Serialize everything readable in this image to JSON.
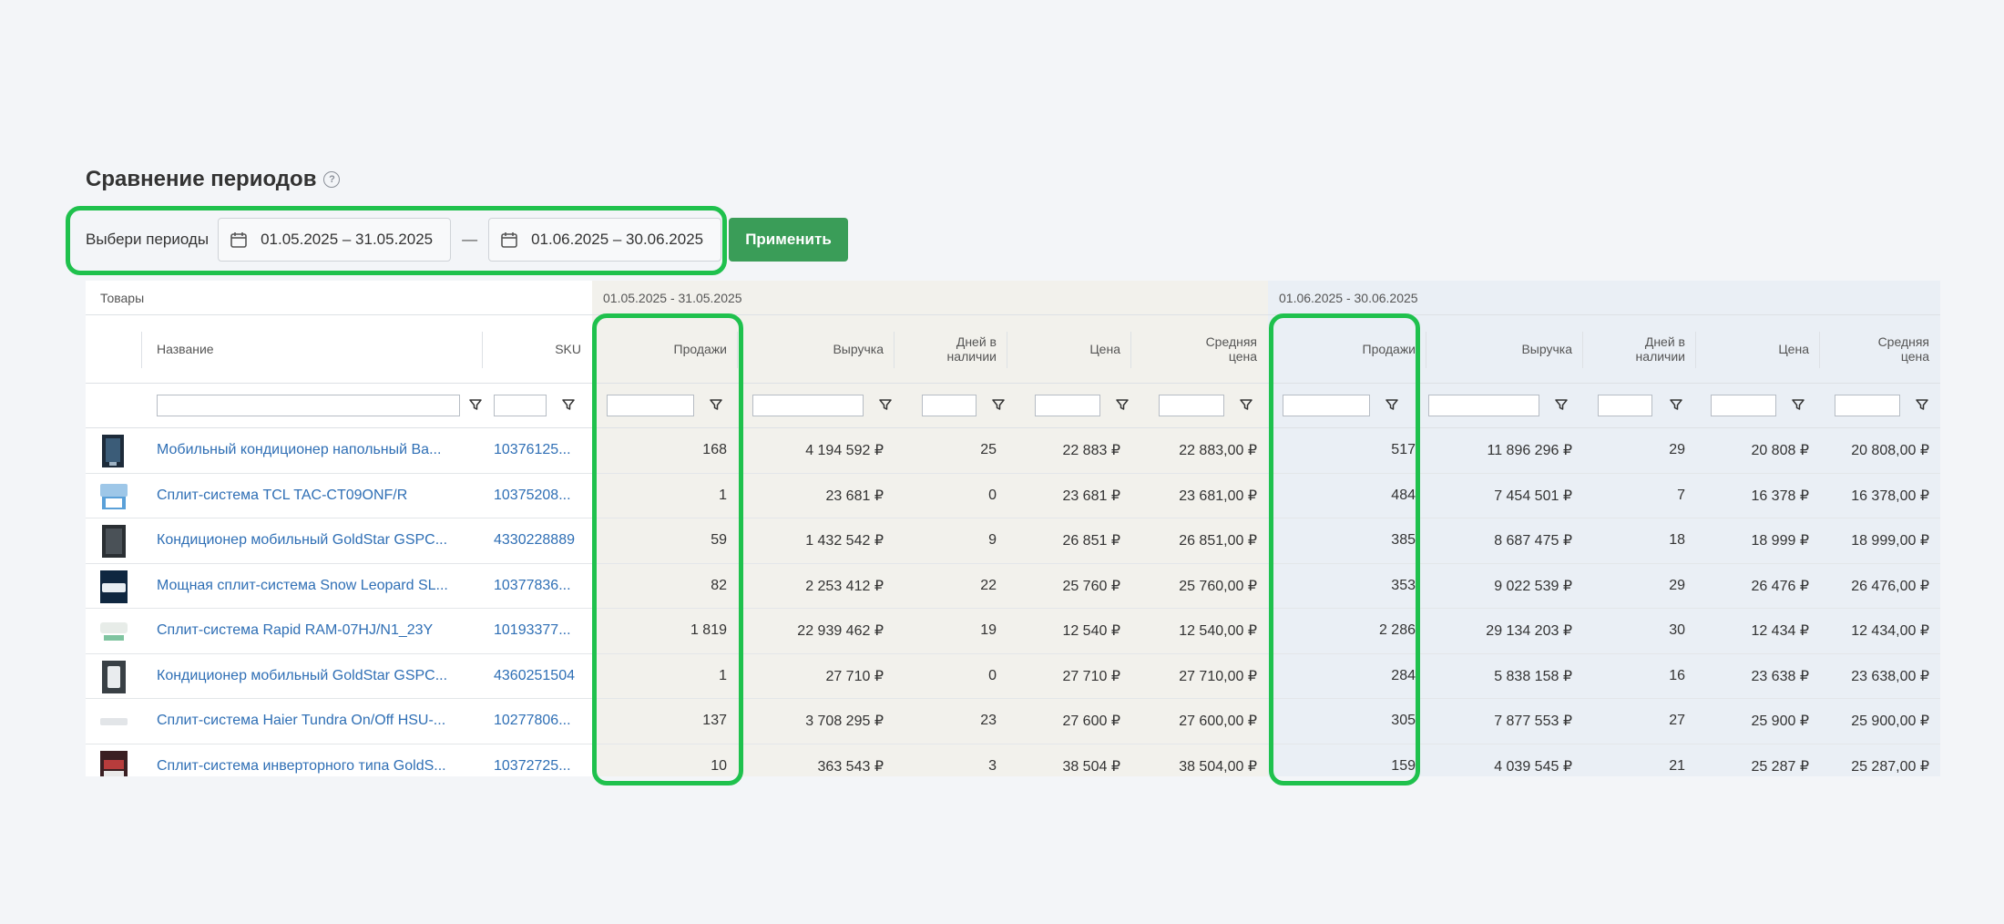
{
  "page": {
    "title": "Сравнение периодов",
    "help_icon": "?",
    "period_label": "Выбери периоды",
    "period1": "01.05.2025 – 31.05.2025",
    "period_sep": "—",
    "period2": "01.06.2025 – 30.06.2025",
    "apply_label": "Применить"
  },
  "table": {
    "group_products": "Товары",
    "group_period1": "01.05.2025 - 31.05.2025",
    "group_period2": "01.06.2025 - 30.06.2025",
    "col_name": "Название",
    "col_sku": "SKU",
    "col_sales": "Продажи",
    "col_revenue": "Выручка",
    "col_days": "Дней в наличии",
    "col_price": "Цена",
    "col_avg_price": "Средняя цена",
    "rows": [
      {
        "name": "Мобильный кондиционер напольный Ва...",
        "sku": "10376125...",
        "p1": {
          "sales": "168",
          "rev": "4 194 592 ₽",
          "days": "25",
          "price": "22 883 ₽",
          "avg": "22 883,00 ₽"
        },
        "p2": {
          "sales": "517",
          "rev": "11 896 296 ₽",
          "days": "29",
          "price": "20 808 ₽",
          "avg": "20 808,00 ₽"
        }
      },
      {
        "name": "Сплит-система TCL TAC-CT09ONF/R",
        "sku": "10375208...",
        "p1": {
          "sales": "1",
          "rev": "23 681 ₽",
          "days": "0",
          "price": "23 681 ₽",
          "avg": "23 681,00 ₽"
        },
        "p2": {
          "sales": "484",
          "rev": "7 454 501 ₽",
          "days": "7",
          "price": "16 378 ₽",
          "avg": "16 378,00 ₽"
        }
      },
      {
        "name": "Кондиционер мобильный GoldStar GSPC...",
        "sku": "4330228889",
        "p1": {
          "sales": "59",
          "rev": "1 432 542 ₽",
          "days": "9",
          "price": "26 851 ₽",
          "avg": "26 851,00 ₽"
        },
        "p2": {
          "sales": "385",
          "rev": "8 687 475 ₽",
          "days": "18",
          "price": "18 999 ₽",
          "avg": "18 999,00 ₽"
        }
      },
      {
        "name": "Мощная сплит-система Snow Leopard SL...",
        "sku": "10377836...",
        "p1": {
          "sales": "82",
          "rev": "2 253 412 ₽",
          "days": "22",
          "price": "25 760 ₽",
          "avg": "25 760,00 ₽"
        },
        "p2": {
          "sales": "353",
          "rev": "9 022 539 ₽",
          "days": "29",
          "price": "26 476 ₽",
          "avg": "26 476,00 ₽"
        }
      },
      {
        "name": "Сплит-система Rapid RAM-07HJ/N1_23Y",
        "sku": "10193377...",
        "p1": {
          "sales": "1 819",
          "rev": "22 939 462 ₽",
          "days": "19",
          "price": "12 540 ₽",
          "avg": "12 540,00 ₽"
        },
        "p2": {
          "sales": "2 286",
          "rev": "29 134 203 ₽",
          "days": "30",
          "price": "12 434 ₽",
          "avg": "12 434,00 ₽"
        }
      },
      {
        "name": "Кондиционер мобильный GoldStar GSPC...",
        "sku": "4360251504",
        "p1": {
          "sales": "1",
          "rev": "27 710 ₽",
          "days": "0",
          "price": "27 710 ₽",
          "avg": "27 710,00 ₽"
        },
        "p2": {
          "sales": "284",
          "rev": "5 838 158 ₽",
          "days": "16",
          "price": "23 638 ₽",
          "avg": "23 638,00 ₽"
        }
      },
      {
        "name": "Сплит-система Haier Tundra On/Off HSU-...",
        "sku": "10277806...",
        "p1": {
          "sales": "137",
          "rev": "3 708 295 ₽",
          "days": "23",
          "price": "27 600 ₽",
          "avg": "27 600,00 ₽"
        },
        "p2": {
          "sales": "305",
          "rev": "7 877 553 ₽",
          "days": "27",
          "price": "25 900 ₽",
          "avg": "25 900,00 ₽"
        }
      },
      {
        "name": "Сплит-система инверторного типа GoldS...",
        "sku": "10372725...",
        "p1": {
          "sales": "10",
          "rev": "363 543 ₽",
          "days": "3",
          "price": "38 504 ₽",
          "avg": "38 504,00 ₽"
        },
        "p2": {
          "sales": "159",
          "rev": "4 039 545 ₽",
          "days": "21",
          "price": "25 287 ₽",
          "avg": "25 287,00 ₽"
        }
      }
    ]
  },
  "colors": {
    "accent_green": "#3a9d58",
    "highlight": "#1fc14d",
    "link": "#2f6fb5"
  },
  "icons": {
    "calendar": "calendar-icon",
    "filter": "filter-icon",
    "help": "help-icon"
  }
}
